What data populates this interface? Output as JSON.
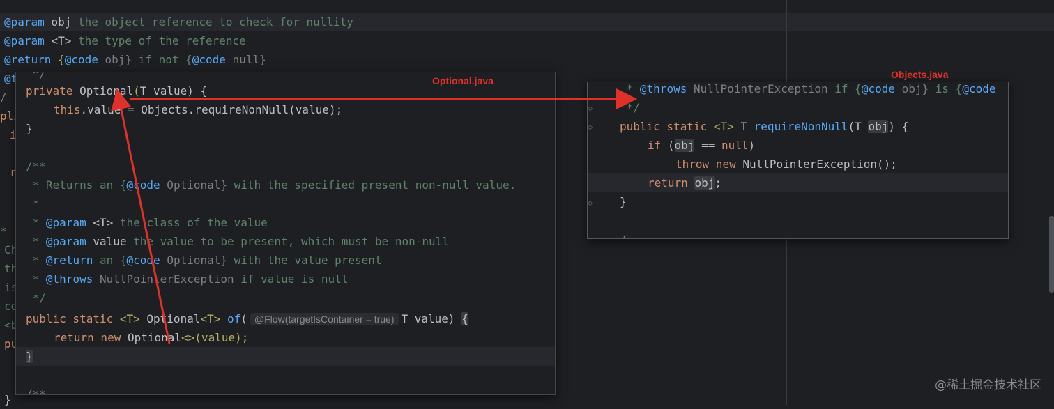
{
  "background_editor": {
    "lines": [
      {
        "tag": "@param",
        "name": "obj",
        "text": " the object reference to check for nullity"
      },
      {
        "tag": "@param",
        "name": "<T>",
        "text": " the type of the reference"
      },
      {
        "tag": "@return",
        "pre": " {",
        "code_tag": "@code",
        "code_text": " obj}",
        "mid": " if not {",
        "code_tag2": "@code",
        "code_text2": " null}"
      }
    ],
    "left_fragments": [
      "@t",
      "/",
      "pli",
      "i",
      "r",
      "*",
      "Ch",
      "th",
      "is",
      "co",
      "<b",
      "pu",
      "}"
    ]
  },
  "optional_popup": {
    "label": "Optional.java",
    "lines": {
      "l0": " */",
      "l1_kw": "private",
      "l1_type": "Optional",
      "l1_rest_a": "(",
      "l1_T": "T",
      "l1_rest_b": " value) {",
      "l2_kw": "this",
      "l2_a": ".value = ",
      "l2_cls": "Objects",
      "l2_b": ".requireNonNull(value);",
      "l3": "}",
      "l5": "/**",
      "l6_a": " * Returns an {",
      "l6_tag": "@code",
      "l6_b": " Optional}",
      "l6_c": " with the specified present non-null value.",
      "l7": " *",
      "l8_a": " * ",
      "l8_tag": "@param",
      "l8_n": " <T>",
      "l8_b": " the class of the value",
      "l9_a": " * ",
      "l9_tag": "@param",
      "l9_n": " value",
      "l9_b": " the value to be present, which must be non-null",
      "l10_a": " * ",
      "l10_tag": "@return",
      "l10_b": " an {",
      "l10_ctag": "@code",
      "l10_c": " Optional}",
      "l10_d": " with the value present",
      "l11_a": " * ",
      "l11_tag": "@throws",
      "l11_n": " NullPointerException",
      "l11_b": " if value is null",
      "l12": " */",
      "l13_kw1": "public",
      "l13_kw2": " static",
      "l13_t": " <T>",
      "l13_type": " Optional",
      "l13_g": "<T>",
      "l13_fn": " of",
      "l13_paren": "(",
      "l13_inlay": "@Flow(targetIsContainer = true)",
      "l13_b": "T value) ",
      "l13_brace": "{",
      "l14_kw": "return",
      "l14_kw2": " new",
      "l14_type": " Optional",
      "l14_b": "<>(value);",
      "l15": "}",
      "l17": "/**"
    }
  },
  "objects_popup": {
    "label": "Objects.java",
    "lines": {
      "l0_a": " * ",
      "l0_tag": "@throws",
      "l0_n": " NullPointerException",
      "l0_b": " if {",
      "l0_ctag": "@code",
      "l0_c": " obj}",
      "l0_d": " is {",
      "l0_ctag2": "@code",
      "l1": " */",
      "l2_kw1": "public",
      "l2_kw2": " static",
      "l2_t": " <T>",
      "l2_T": " T",
      "l2_fn": " requireNonNull",
      "l2_a": "(T ",
      "l2_obj": "obj",
      "l2_b": ") {",
      "l3_kw": "if",
      "l3_a": " (",
      "l3_obj": "obj",
      "l3_b": " == ",
      "l3_null": "null",
      "l3_c": ")",
      "l4_kw": "throw",
      "l4_kw2": " new",
      "l4_a": " NullPointerException();",
      "l5_kw": "return",
      "l5_obj": "obj",
      "l5_a": ";",
      "l6": "}",
      "l8": "/"
    }
  },
  "watermark": "@稀土掘金技术社区",
  "colors": {
    "background": "#1e1f22",
    "keyword": "#cf8e6d",
    "doc": "#5f826b",
    "method": "#56a8f5",
    "annotation_red": "#e0302a"
  }
}
